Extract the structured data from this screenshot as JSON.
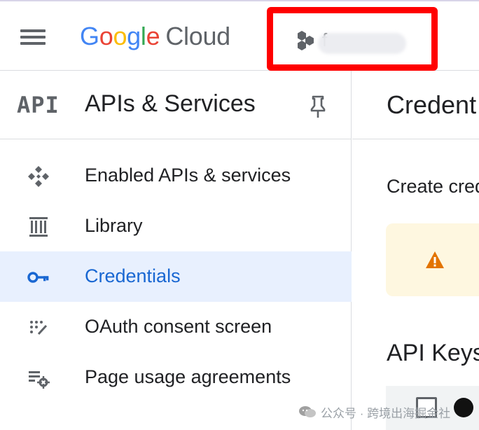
{
  "header": {
    "logo": {
      "google": [
        "G",
        "o",
        "o",
        "g",
        "l",
        "e"
      ],
      "cloud": "Cloud"
    },
    "project": {
      "name": "f"
    }
  },
  "sidebar": {
    "badge": "API",
    "title": "APIs & Services",
    "items": [
      {
        "label": "Enabled APIs & services",
        "icon": "enabled-apis-icon",
        "active": false
      },
      {
        "label": "Library",
        "icon": "library-icon",
        "active": false
      },
      {
        "label": "Credentials",
        "icon": "key-icon",
        "active": true
      },
      {
        "label": "OAuth consent screen",
        "icon": "oauth-consent-icon",
        "active": false
      },
      {
        "label": "Page usage agreements",
        "icon": "usage-agreements-icon",
        "active": false
      }
    ]
  },
  "main": {
    "title": "Credent",
    "subtitle": "Create cred",
    "section": "API Keys"
  },
  "watermark": "公众号 · 跨境出海掘金社",
  "colors": {
    "accent": "#1967d2",
    "active_bg": "#e8f0fe",
    "highlight_border": "#ff0000",
    "warning": "#e37400"
  }
}
